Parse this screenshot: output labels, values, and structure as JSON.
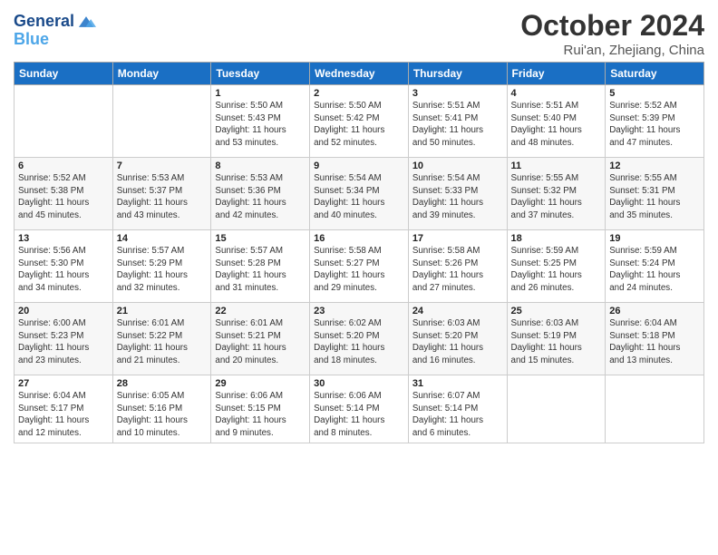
{
  "header": {
    "logo_line1": "General",
    "logo_line2": "Blue",
    "month": "October 2024",
    "location": "Rui'an, Zhejiang, China"
  },
  "days_of_week": [
    "Sunday",
    "Monday",
    "Tuesday",
    "Wednesday",
    "Thursday",
    "Friday",
    "Saturday"
  ],
  "weeks": [
    [
      {
        "day": "",
        "info": ""
      },
      {
        "day": "",
        "info": ""
      },
      {
        "day": "1",
        "info": "Sunrise: 5:50 AM\nSunset: 5:43 PM\nDaylight: 11 hours\nand 53 minutes."
      },
      {
        "day": "2",
        "info": "Sunrise: 5:50 AM\nSunset: 5:42 PM\nDaylight: 11 hours\nand 52 minutes."
      },
      {
        "day": "3",
        "info": "Sunrise: 5:51 AM\nSunset: 5:41 PM\nDaylight: 11 hours\nand 50 minutes."
      },
      {
        "day": "4",
        "info": "Sunrise: 5:51 AM\nSunset: 5:40 PM\nDaylight: 11 hours\nand 48 minutes."
      },
      {
        "day": "5",
        "info": "Sunrise: 5:52 AM\nSunset: 5:39 PM\nDaylight: 11 hours\nand 47 minutes."
      }
    ],
    [
      {
        "day": "6",
        "info": "Sunrise: 5:52 AM\nSunset: 5:38 PM\nDaylight: 11 hours\nand 45 minutes."
      },
      {
        "day": "7",
        "info": "Sunrise: 5:53 AM\nSunset: 5:37 PM\nDaylight: 11 hours\nand 43 minutes."
      },
      {
        "day": "8",
        "info": "Sunrise: 5:53 AM\nSunset: 5:36 PM\nDaylight: 11 hours\nand 42 minutes."
      },
      {
        "day": "9",
        "info": "Sunrise: 5:54 AM\nSunset: 5:34 PM\nDaylight: 11 hours\nand 40 minutes."
      },
      {
        "day": "10",
        "info": "Sunrise: 5:54 AM\nSunset: 5:33 PM\nDaylight: 11 hours\nand 39 minutes."
      },
      {
        "day": "11",
        "info": "Sunrise: 5:55 AM\nSunset: 5:32 PM\nDaylight: 11 hours\nand 37 minutes."
      },
      {
        "day": "12",
        "info": "Sunrise: 5:55 AM\nSunset: 5:31 PM\nDaylight: 11 hours\nand 35 minutes."
      }
    ],
    [
      {
        "day": "13",
        "info": "Sunrise: 5:56 AM\nSunset: 5:30 PM\nDaylight: 11 hours\nand 34 minutes."
      },
      {
        "day": "14",
        "info": "Sunrise: 5:57 AM\nSunset: 5:29 PM\nDaylight: 11 hours\nand 32 minutes."
      },
      {
        "day": "15",
        "info": "Sunrise: 5:57 AM\nSunset: 5:28 PM\nDaylight: 11 hours\nand 31 minutes."
      },
      {
        "day": "16",
        "info": "Sunrise: 5:58 AM\nSunset: 5:27 PM\nDaylight: 11 hours\nand 29 minutes."
      },
      {
        "day": "17",
        "info": "Sunrise: 5:58 AM\nSunset: 5:26 PM\nDaylight: 11 hours\nand 27 minutes."
      },
      {
        "day": "18",
        "info": "Sunrise: 5:59 AM\nSunset: 5:25 PM\nDaylight: 11 hours\nand 26 minutes."
      },
      {
        "day": "19",
        "info": "Sunrise: 5:59 AM\nSunset: 5:24 PM\nDaylight: 11 hours\nand 24 minutes."
      }
    ],
    [
      {
        "day": "20",
        "info": "Sunrise: 6:00 AM\nSunset: 5:23 PM\nDaylight: 11 hours\nand 23 minutes."
      },
      {
        "day": "21",
        "info": "Sunrise: 6:01 AM\nSunset: 5:22 PM\nDaylight: 11 hours\nand 21 minutes."
      },
      {
        "day": "22",
        "info": "Sunrise: 6:01 AM\nSunset: 5:21 PM\nDaylight: 11 hours\nand 20 minutes."
      },
      {
        "day": "23",
        "info": "Sunrise: 6:02 AM\nSunset: 5:20 PM\nDaylight: 11 hours\nand 18 minutes."
      },
      {
        "day": "24",
        "info": "Sunrise: 6:03 AM\nSunset: 5:20 PM\nDaylight: 11 hours\nand 16 minutes."
      },
      {
        "day": "25",
        "info": "Sunrise: 6:03 AM\nSunset: 5:19 PM\nDaylight: 11 hours\nand 15 minutes."
      },
      {
        "day": "26",
        "info": "Sunrise: 6:04 AM\nSunset: 5:18 PM\nDaylight: 11 hours\nand 13 minutes."
      }
    ],
    [
      {
        "day": "27",
        "info": "Sunrise: 6:04 AM\nSunset: 5:17 PM\nDaylight: 11 hours\nand 12 minutes."
      },
      {
        "day": "28",
        "info": "Sunrise: 6:05 AM\nSunset: 5:16 PM\nDaylight: 11 hours\nand 10 minutes."
      },
      {
        "day": "29",
        "info": "Sunrise: 6:06 AM\nSunset: 5:15 PM\nDaylight: 11 hours\nand 9 minutes."
      },
      {
        "day": "30",
        "info": "Sunrise: 6:06 AM\nSunset: 5:14 PM\nDaylight: 11 hours\nand 8 minutes."
      },
      {
        "day": "31",
        "info": "Sunrise: 6:07 AM\nSunset: 5:14 PM\nDaylight: 11 hours\nand 6 minutes."
      },
      {
        "day": "",
        "info": ""
      },
      {
        "day": "",
        "info": ""
      }
    ]
  ]
}
